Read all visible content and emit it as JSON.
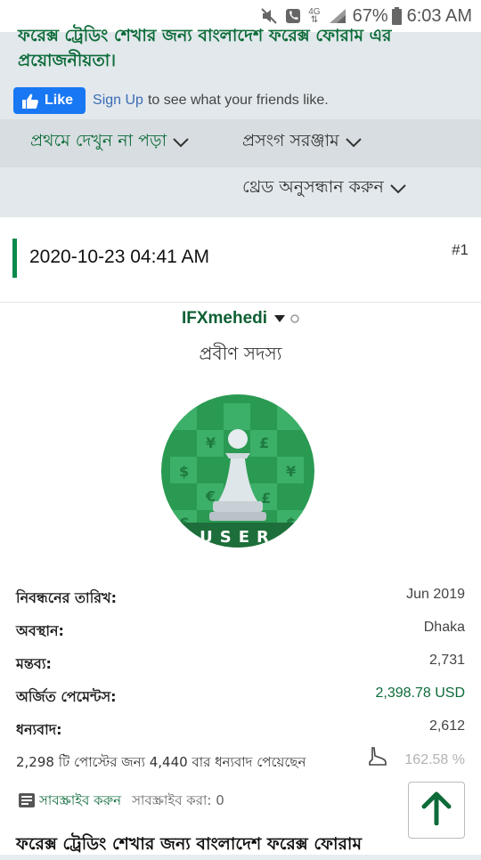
{
  "status_bar": {
    "battery_percent": "67%",
    "time": "6:03 AM",
    "network": "4G"
  },
  "page": {
    "title": "ফরেক্স ট্রেডিং শেখার জন্য বাংলাদেশ ফরেক্স ফোরাম এর প্রয়োজনীয়তা।"
  },
  "facebook": {
    "like_label": "Like",
    "signup_label": "Sign Up",
    "signup_text": "to see what your friends like."
  },
  "nav": {
    "first_unread": "প্রথমে দেখুন না পড়া",
    "topic_tools": "প্রসংগ সরঞ্জাম",
    "thread_search": "থ্রেড অনুসন্ধান করুন"
  },
  "post": {
    "date": "2020-10-23 04:41 AM",
    "number": "#1",
    "username": "IFXmehedi",
    "rank": "প্রবীণ সদস্য",
    "avatar_text": "USER",
    "stats": [
      {
        "label": "নিবন্ধনের তারিখ:",
        "value": "Jun 2019"
      },
      {
        "label": "অবস্থান:",
        "value": "Dhaka"
      },
      {
        "label": "মন্তব্য:",
        "value": "2,731"
      },
      {
        "label": "অর্জিত পেমেন্টস:",
        "value": "2,398.78 USD"
      },
      {
        "label": "ধন্যবাদ:",
        "value": "2,612"
      }
    ],
    "thanks_received": "2,298 টি পোস্টের জন্য 4,440 বার ধন্যবাদ পেয়েছেন",
    "thanks_percent": "162.58 %",
    "subscribe_label": "সাবস্ক্রাইব করুন",
    "subscribed_label": "সাবস্ক্রাইব করা: 0",
    "bottom_title": "ফরেক্স ট্রেডিং শেখার জন্য বাংলাদেশ ফরেক্স ফোরাম"
  },
  "colors": {
    "accent_green": "#0d6b39",
    "facebook_blue": "#1877f2",
    "header_bg": "#e2e8ec"
  }
}
